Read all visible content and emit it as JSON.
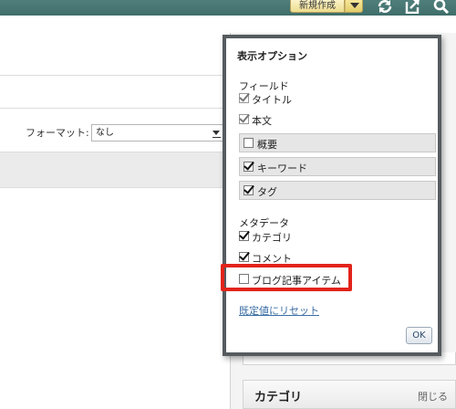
{
  "toolbar": {
    "new_button_label": "新規作成",
    "icons": [
      "chevron-down-icon",
      "refresh-icon",
      "export-icon",
      "search-icon"
    ]
  },
  "editor": {
    "format_label": "フォーマット:",
    "format_value": "なし"
  },
  "sidebar": {
    "category_title": "カテゴリ",
    "category_close": "閉じる"
  },
  "display_options": {
    "title": "表示オプション",
    "fields_heading": "フィールド",
    "fields": [
      {
        "label": "タイトル",
        "checked": true,
        "locked": true
      },
      {
        "label": "本文",
        "checked": true,
        "locked": true
      },
      {
        "label": "概要",
        "checked": false,
        "locked": false
      },
      {
        "label": "キーワード",
        "checked": true,
        "locked": false
      },
      {
        "label": "タグ",
        "checked": true,
        "locked": false
      }
    ],
    "metadata_heading": "メタデータ",
    "metadata": [
      {
        "label": "カテゴリ",
        "checked": true
      },
      {
        "label": "コメント",
        "checked": true
      },
      {
        "label": "ブログ記事アイテム",
        "checked": false
      }
    ],
    "reset_link": "既定値にリセット",
    "ok_button": "OK"
  },
  "colors": {
    "topbar": "#4f7f7c",
    "popup_border": "#555b5e",
    "highlight": "#e2231a",
    "link": "#3a6ea5"
  }
}
